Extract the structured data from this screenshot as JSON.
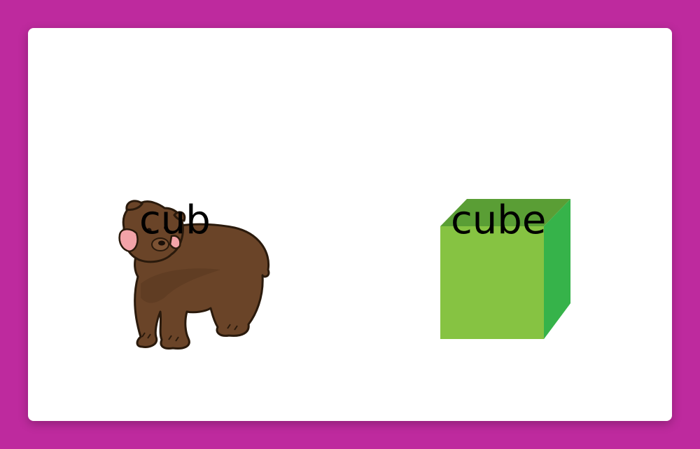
{
  "colors": {
    "background": "#be2a9e",
    "card": "#ffffff",
    "cube_front": "#86c342",
    "cube_top": "#5a9e35",
    "cube_side": "#36b34a",
    "bear_body": "#6a4428",
    "bear_cheek": "#f2a3a8"
  },
  "cards": [
    {
      "word": "cub",
      "picture": "bear-cub-illustration"
    },
    {
      "word": "cube",
      "picture": "green-cube-illustration"
    }
  ]
}
